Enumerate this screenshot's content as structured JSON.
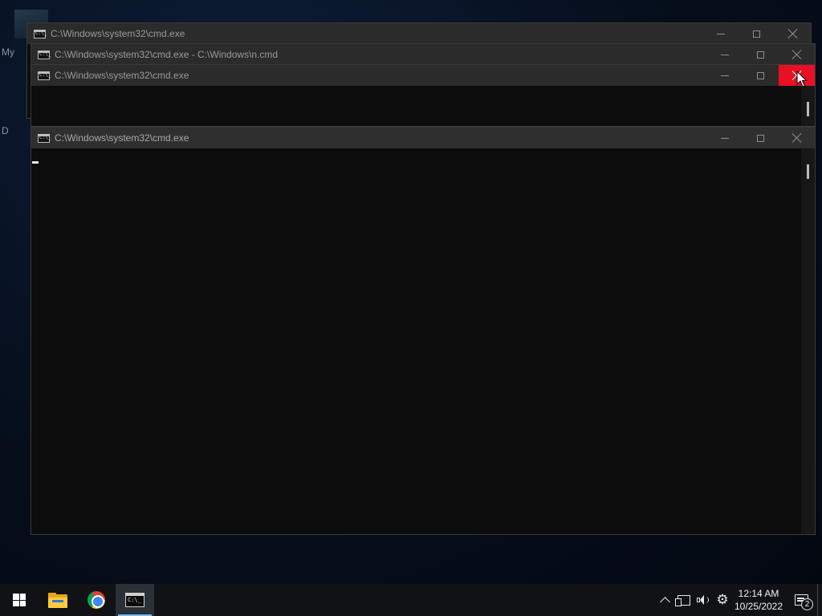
{
  "desktop": {
    "label_fragment_1": "My",
    "label_fragment_2": "D"
  },
  "windows": [
    {
      "title": "C:\\Windows\\system32\\cmd.exe",
      "state": "background"
    },
    {
      "title": "C:\\Windows\\system32\\cmd.exe - C:\\Windows\\n.cmd",
      "state": "background"
    },
    {
      "title": "C:\\Windows\\system32\\cmd.exe",
      "state": "background",
      "close_hovered": true
    },
    {
      "title": "C:\\Windows\\system32\\cmd.exe",
      "state": "active"
    }
  ],
  "cmd_icon_glyph": "C:\\_",
  "taskbar": {
    "start_icon": "windows-logo",
    "pinned": [
      {
        "name": "file-explorer",
        "icon": "folder-icon",
        "active": false
      },
      {
        "name": "google-chrome",
        "icon": "chrome-icon",
        "active": false
      },
      {
        "name": "command-prompt",
        "icon": "cmd-icon",
        "active": true
      }
    ],
    "tray": {
      "time": "12:14 AM",
      "date": "10/25/2022",
      "notification_count": "2"
    }
  },
  "colors": {
    "close_hover": "#e81123",
    "console_bg": "#0c0c0c",
    "taskbar_bg": "#101215",
    "active_underline": "#76b9ed"
  }
}
